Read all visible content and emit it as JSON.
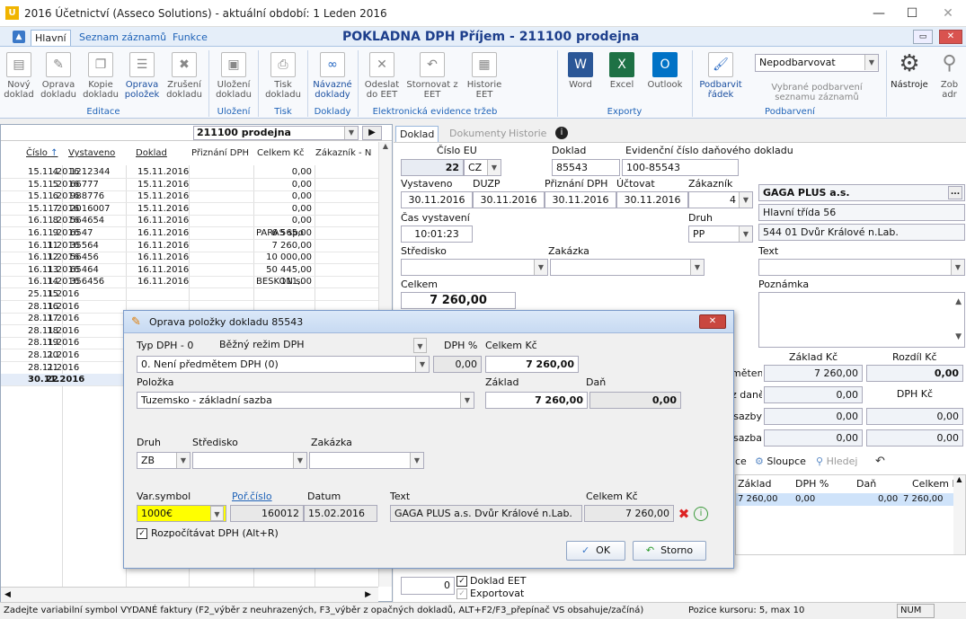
{
  "window": {
    "title": "2016 Účetnictví (Asseco Solutions) - aktuální období: 1 Leden 2016",
    "app_icon": "U",
    "minimize": "—",
    "maximize": "☐",
    "close": "✕"
  },
  "ribbon_tabs": [
    "Hlavní",
    "Seznam záznamů",
    "Funkce"
  ],
  "document_title": "POKLADNA DPH Příjem - 211100 prodejna",
  "ribbon": {
    "buttons": [
      {
        "label": "Nový doklad",
        "icon": "new-doc-icon"
      },
      {
        "label": "Oprava dokladu",
        "icon": "edit-doc-icon"
      },
      {
        "label": "Kopie dokladu",
        "icon": "copy-doc-icon"
      },
      {
        "label": "Oprava položek",
        "icon": "edit-items-icon"
      },
      {
        "label": "Zrušení dokladu",
        "icon": "cancel-doc-icon"
      },
      {
        "label": "Uložení dokladu",
        "icon": "save-icon"
      },
      {
        "label": "Tisk dokladu",
        "icon": "print-icon"
      },
      {
        "label": "Návazné doklady",
        "icon": "link-icon"
      },
      {
        "label": "Odeslat do EET",
        "icon": "eet-send-icon"
      },
      {
        "label": "Stornovat z EET",
        "icon": "eet-storno-icon"
      },
      {
        "label": "Historie EET",
        "icon": "eet-history-icon"
      },
      {
        "label": "Word",
        "icon": "word-icon"
      },
      {
        "label": "Excel",
        "icon": "excel-icon"
      },
      {
        "label": "Outlook",
        "icon": "outlook-icon"
      },
      {
        "label": "Podbarvit řádek",
        "icon": "brush-icon"
      },
      {
        "label": "Nástroje",
        "icon": "gear-icon"
      },
      {
        "label": "Zob adr",
        "icon": "pin-icon"
      }
    ],
    "groups": [
      "Editace",
      "Uložení",
      "Tisk",
      "Doklady",
      "Elektronická evidence tržeb",
      "Exporty",
      "Podbarvení"
    ],
    "color_select": "Nepodbarvovat",
    "color_note": "Vybrané podbarvení seznamu záznamů"
  },
  "list": {
    "filter": "211100  prodejna",
    "columns": [
      "Číslo",
      "Vystaveno",
      "Doklad",
      "Přiznání DPH",
      "Celkem Kč",
      "Zákazník - N"
    ],
    "sort_arrow": "↑",
    "rows": [
      [
        "4",
        "15.11.2016",
        "1212344",
        "15.11.2016",
        "0,00",
        ""
      ],
      [
        "5",
        "15.11.2016",
        "66777",
        "15.11.2016",
        "0,00",
        ""
      ],
      [
        "6",
        "15.11.2016",
        "988776",
        "15.11.2016",
        "0,00",
        ""
      ],
      [
        "7",
        "15.11.2016",
        "2016007",
        "15.11.2016",
        "0,00",
        ""
      ],
      [
        "8",
        "16.11.2016",
        "564654",
        "16.11.2016",
        "0,00",
        ""
      ],
      [
        "9",
        "16.11.2016",
        "6547",
        "16.11.2016",
        "6 565,00",
        "PARAS spo"
      ],
      [
        "11",
        "16.11.2016",
        "35564",
        "16.11.2016",
        "7 260,00",
        ""
      ],
      [
        "12",
        "16.11.2016",
        "56456",
        "16.11.2016",
        "10 000,00",
        ""
      ],
      [
        "13",
        "16.11.2016",
        "65464",
        "16.11.2016",
        "50 445,00",
        ""
      ],
      [
        "14",
        "16.11.2016",
        "356456",
        "16.11.2016",
        "111,00",
        "BESKON s."
      ],
      [
        "15",
        "25.11.2016",
        "",
        "",
        "",
        ""
      ],
      [
        "16",
        "28.11.2016",
        "",
        "",
        "",
        ""
      ],
      [
        "17",
        "28.11.2016",
        "",
        "",
        "",
        ""
      ],
      [
        "18",
        "28.11.2016",
        "",
        "",
        "",
        ""
      ],
      [
        "19",
        "28.11.2016",
        "",
        "",
        "",
        ""
      ],
      [
        "20",
        "28.11.2016",
        "",
        "",
        "",
        ""
      ],
      [
        "21",
        "28.11.2016",
        "",
        "",
        "",
        ""
      ],
      [
        "22",
        "30.11.2016",
        "",
        "",
        "",
        ""
      ]
    ]
  },
  "detail": {
    "tabs": [
      "Doklad",
      "Dokumenty",
      "Historie"
    ],
    "cislo_eu_label": "Číslo EU",
    "cislo_eu": "22",
    "country": "CZ",
    "doklad_label": "Doklad",
    "doklad": "85543",
    "evidencni_label": "Evidenční číslo daňového dokladu",
    "evidencni": "100-85543",
    "vystaveno_label": "Vystaveno",
    "vystaveno": "30.11.2016",
    "duzp_label": "DUZP",
    "duzp": "30.11.2016",
    "priznani_label": "Přiznání DPH",
    "priznani": "30.11.2016",
    "uctovat_label": "Účtovat",
    "uctovat": "30.11.2016",
    "zakaznik_label": "Zákazník",
    "zakaznik_num": "4",
    "customer_name": "GAGA PLUS a.s.",
    "customer_street": "Hlavní třída 56",
    "customer_city": "544 01 Dvůr Králové n.Lab.",
    "cas_label": "Čas vystavení",
    "cas": "10:01:23",
    "druh_label": "Druh",
    "druh": "PP",
    "stredisko_label": "Středisko",
    "zakazka_label": "Zakázka",
    "text_label": "Text",
    "celkem_label": "Celkem",
    "celkem": "7 260,00",
    "poznamka_label": "Poznámka",
    "summary": {
      "col_zaklad": "Základ Kč",
      "col_rozdil": "Rozdíl Kč",
      "rows": [
        {
          "label": "mětem",
          "zaklad": "7 260,00",
          "rozdil": "0,00"
        },
        {
          "label": "z daně",
          "zaklad": "0,00",
          "rozdil": "DPH Kč"
        },
        {
          "label": "sazby",
          "zaklad": "0,00",
          "rozdil": "0,00"
        },
        {
          "label": "sazba",
          "zaklad": "0,00",
          "rozdil": "0,00"
        }
      ]
    },
    "items_toolbar": {
      "sloupce": "Sloupce",
      "hledej": "Hledej",
      "left": "ce"
    },
    "items_columns": [
      "Základ",
      "DPH %",
      "Daň",
      "Celkem K"
    ],
    "items_row": [
      "7 260,00",
      "0,00",
      "0,00",
      "7 260,00"
    ],
    "doklad_eet": "Doklad EET",
    "exportovat": "Exportovat",
    "eet_count": "0"
  },
  "dialog": {
    "title": "Oprava položky dokladu 85543",
    "typ_dph_label": "Typ DPH - 0",
    "typ_dph_mode": "Běžný režim DPH",
    "dph_pct_label": "DPH %",
    "celkem_label": "Celkem Kč",
    "typ_dph_value": "0. Není předmětem DPH (0)",
    "dph_pct": "0,00",
    "celkem": "7 260,00",
    "polozka_label": "Položka",
    "zaklad_label": "Základ",
    "dan_label": "Daň",
    "polozka_value": "Tuzemsko - základní sazba",
    "zaklad": "7 260,00",
    "dan": "0,00",
    "druh_label": "Druh",
    "stredisko_label": "Středisko",
    "zakazka_label": "Zakázka",
    "druh_value": "ZB",
    "var_symbol_label": "Var.symbol",
    "por_cislo_label": "Poř.číslo",
    "datum_label": "Datum",
    "text_label": "Text",
    "celkem2_label": "Celkem Kč",
    "var_symbol": "1000€",
    "por_cislo": "160012",
    "datum": "15.02.2016",
    "text": "GAGA PLUS a.s.  Dvůr Králové n.Lab.",
    "celkem2": "7 260,00",
    "rozpocitavat": "Rozpočítávat DPH (Alt+R)",
    "ok": "OK",
    "storno": "Storno",
    "highlight_color": "#ffff00"
  },
  "status": {
    "text": "Zadejte variabilní symbol VYDANÉ faktury (F2_výběr z neuhrazených, F3_výběr z opačných dokladů, ALT+F2/F3_přepínač VS obsahuje/začíná)",
    "cursor": "Pozice kursoru: 5, max 10",
    "num": "NUM"
  }
}
